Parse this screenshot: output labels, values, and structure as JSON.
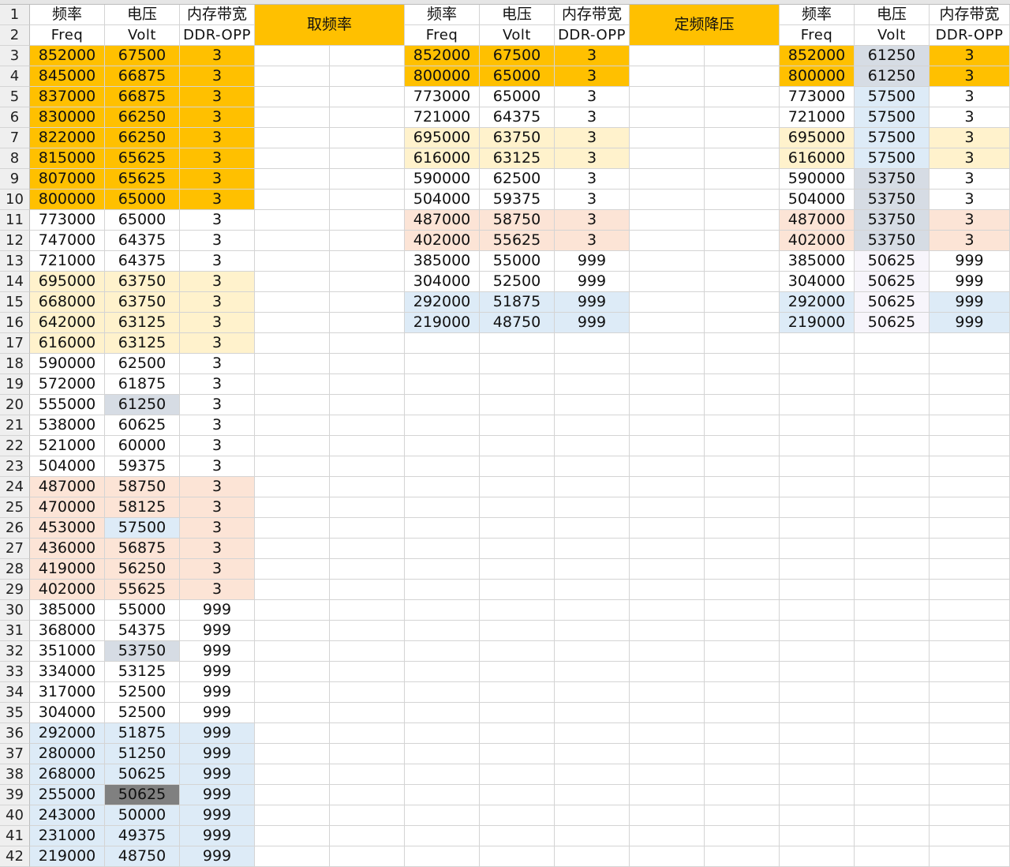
{
  "colors": {
    "orange": "#ffc000",
    "yellow": "#fff2cc",
    "peach": "#fce4d6",
    "blue": "#ddebf7",
    "gray": "#d6dce4",
    "dark": "#808080",
    "lavender": "#f7f5fb"
  },
  "headers": {
    "freq_cn": "频率",
    "volt_cn": "电压",
    "ddr_cn": "内存带宽",
    "freq_en": "Freq",
    "volt_en": "Volt",
    "ddr_en": "DDR-OPP",
    "label_take": "取频率",
    "label_fixed": "定频降压"
  },
  "row_numbers": [
    1,
    2,
    3,
    4,
    5,
    6,
    7,
    8,
    9,
    10,
    11,
    12,
    13,
    14,
    15,
    16,
    17,
    18,
    19,
    20,
    21,
    22,
    23,
    24,
    25,
    26,
    27,
    28,
    29,
    30,
    31,
    32,
    33,
    34,
    35,
    36,
    37,
    38,
    39,
    40,
    41,
    42
  ],
  "table_full": [
    {
      "freq": "852000",
      "volt": "67500",
      "ddr": "3",
      "bg": "orange"
    },
    {
      "freq": "845000",
      "volt": "66875",
      "ddr": "3",
      "bg": "orange"
    },
    {
      "freq": "837000",
      "volt": "66875",
      "ddr": "3",
      "bg": "orange"
    },
    {
      "freq": "830000",
      "volt": "66250",
      "ddr": "3",
      "bg": "orange"
    },
    {
      "freq": "822000",
      "volt": "66250",
      "ddr": "3",
      "bg": "orange"
    },
    {
      "freq": "815000",
      "volt": "65625",
      "ddr": "3",
      "bg": "orange"
    },
    {
      "freq": "807000",
      "volt": "65625",
      "ddr": "3",
      "bg": "orange"
    },
    {
      "freq": "800000",
      "volt": "65000",
      "ddr": "3",
      "bg": "orange"
    },
    {
      "freq": "773000",
      "volt": "65000",
      "ddr": "3",
      "bg": ""
    },
    {
      "freq": "747000",
      "volt": "64375",
      "ddr": "3",
      "bg": ""
    },
    {
      "freq": "721000",
      "volt": "64375",
      "ddr": "3",
      "bg": ""
    },
    {
      "freq": "695000",
      "volt": "63750",
      "ddr": "3",
      "bg": "yellow"
    },
    {
      "freq": "668000",
      "volt": "63750",
      "ddr": "3",
      "bg": "yellow"
    },
    {
      "freq": "642000",
      "volt": "63125",
      "ddr": "3",
      "bg": "yellow"
    },
    {
      "freq": "616000",
      "volt": "63125",
      "ddr": "3",
      "bg": "yellow"
    },
    {
      "freq": "590000",
      "volt": "62500",
      "ddr": "3",
      "bg": ""
    },
    {
      "freq": "572000",
      "volt": "61875",
      "ddr": "3",
      "bg": ""
    },
    {
      "freq": "555000",
      "volt": "61250",
      "ddr": "3",
      "bg": "",
      "vbg": "gray"
    },
    {
      "freq": "538000",
      "volt": "60625",
      "ddr": "3",
      "bg": ""
    },
    {
      "freq": "521000",
      "volt": "60000",
      "ddr": "3",
      "bg": ""
    },
    {
      "freq": "504000",
      "volt": "59375",
      "ddr": "3",
      "bg": ""
    },
    {
      "freq": "487000",
      "volt": "58750",
      "ddr": "3",
      "bg": "peach"
    },
    {
      "freq": "470000",
      "volt": "58125",
      "ddr": "3",
      "bg": "peach"
    },
    {
      "freq": "453000",
      "volt": "57500",
      "ddr": "3",
      "bg": "peach",
      "vbg": "blue"
    },
    {
      "freq": "436000",
      "volt": "56875",
      "ddr": "3",
      "bg": "peach"
    },
    {
      "freq": "419000",
      "volt": "56250",
      "ddr": "3",
      "bg": "peach"
    },
    {
      "freq": "402000",
      "volt": "55625",
      "ddr": "3",
      "bg": "peach"
    },
    {
      "freq": "385000",
      "volt": "55000",
      "ddr": "999",
      "bg": ""
    },
    {
      "freq": "368000",
      "volt": "54375",
      "ddr": "999",
      "bg": ""
    },
    {
      "freq": "351000",
      "volt": "53750",
      "ddr": "999",
      "bg": "",
      "vbg": "gray"
    },
    {
      "freq": "334000",
      "volt": "53125",
      "ddr": "999",
      "bg": ""
    },
    {
      "freq": "317000",
      "volt": "52500",
      "ddr": "999",
      "bg": ""
    },
    {
      "freq": "304000",
      "volt": "52500",
      "ddr": "999",
      "bg": ""
    },
    {
      "freq": "292000",
      "volt": "51875",
      "ddr": "999",
      "bg": "blue"
    },
    {
      "freq": "280000",
      "volt": "51250",
      "ddr": "999",
      "bg": "blue"
    },
    {
      "freq": "268000",
      "volt": "50625",
      "ddr": "999",
      "bg": "blue"
    },
    {
      "freq": "255000",
      "volt": "50625",
      "ddr": "999",
      "bg": "blue",
      "vbg": "dark"
    },
    {
      "freq": "243000",
      "volt": "50000",
      "ddr": "999",
      "bg": "blue"
    },
    {
      "freq": "231000",
      "volt": "49375",
      "ddr": "999",
      "bg": "blue"
    },
    {
      "freq": "219000",
      "volt": "48750",
      "ddr": "999",
      "bg": "blue"
    }
  ],
  "table_take": [
    {
      "freq": "852000",
      "volt": "67500",
      "ddr": "3",
      "bg": "orange"
    },
    {
      "freq": "800000",
      "volt": "65000",
      "ddr": "3",
      "bg": "orange"
    },
    {
      "freq": "773000",
      "volt": "65000",
      "ddr": "3",
      "bg": ""
    },
    {
      "freq": "721000",
      "volt": "64375",
      "ddr": "3",
      "bg": ""
    },
    {
      "freq": "695000",
      "volt": "63750",
      "ddr": "3",
      "bg": "yellow"
    },
    {
      "freq": "616000",
      "volt": "63125",
      "ddr": "3",
      "bg": "yellow"
    },
    {
      "freq": "590000",
      "volt": "62500",
      "ddr": "3",
      "bg": ""
    },
    {
      "freq": "504000",
      "volt": "59375",
      "ddr": "3",
      "bg": ""
    },
    {
      "freq": "487000",
      "volt": "58750",
      "ddr": "3",
      "bg": "peach"
    },
    {
      "freq": "402000",
      "volt": "55625",
      "ddr": "3",
      "bg": "peach"
    },
    {
      "freq": "385000",
      "volt": "55000",
      "ddr": "999",
      "bg": ""
    },
    {
      "freq": "304000",
      "volt": "52500",
      "ddr": "999",
      "bg": ""
    },
    {
      "freq": "292000",
      "volt": "51875",
      "ddr": "999",
      "bg": "blue"
    },
    {
      "freq": "219000",
      "volt": "48750",
      "ddr": "999",
      "bg": "blue"
    }
  ],
  "table_fixed": [
    {
      "freq": "852000",
      "volt": "61250",
      "ddr": "3",
      "bg": "orange",
      "vbg": "gray"
    },
    {
      "freq": "800000",
      "volt": "61250",
      "ddr": "3",
      "bg": "orange",
      "vbg": "gray"
    },
    {
      "freq": "773000",
      "volt": "57500",
      "ddr": "3",
      "bg": "",
      "vbg": "blue"
    },
    {
      "freq": "721000",
      "volt": "57500",
      "ddr": "3",
      "bg": "",
      "vbg": "blue"
    },
    {
      "freq": "695000",
      "volt": "57500",
      "ddr": "3",
      "bg": "yellow",
      "vbg": "blue"
    },
    {
      "freq": "616000",
      "volt": "57500",
      "ddr": "3",
      "bg": "yellow",
      "vbg": "blue"
    },
    {
      "freq": "590000",
      "volt": "53750",
      "ddr": "3",
      "bg": "",
      "vbg": "gray"
    },
    {
      "freq": "504000",
      "volt": "53750",
      "ddr": "3",
      "bg": "",
      "vbg": "gray"
    },
    {
      "freq": "487000",
      "volt": "53750",
      "ddr": "3",
      "bg": "peach",
      "vbg": "gray"
    },
    {
      "freq": "402000",
      "volt": "53750",
      "ddr": "3",
      "bg": "peach",
      "vbg": "gray"
    },
    {
      "freq": "385000",
      "volt": "50625",
      "ddr": "999",
      "bg": "",
      "vbg": "lavender"
    },
    {
      "freq": "304000",
      "volt": "50625",
      "ddr": "999",
      "bg": "",
      "vbg": "lavender"
    },
    {
      "freq": "292000",
      "volt": "50625",
      "ddr": "999",
      "bg": "blue",
      "vbg": "lavender"
    },
    {
      "freq": "219000",
      "volt": "50625",
      "ddr": "999",
      "bg": "blue",
      "vbg": "lavender"
    }
  ]
}
